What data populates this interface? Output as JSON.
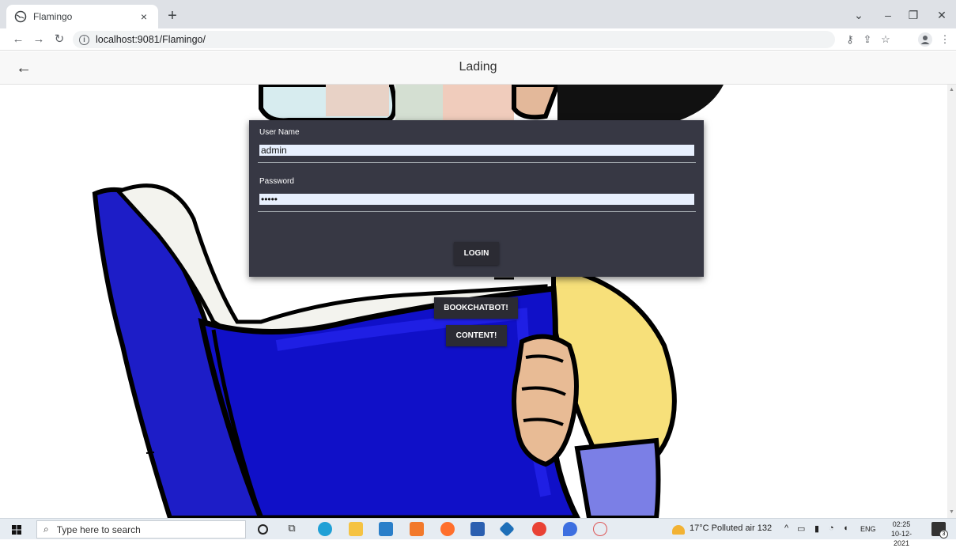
{
  "browser": {
    "tab_title": "Flamingo",
    "tab_close": "×",
    "new_tab": "+",
    "url": "localhost:9081/Flamingo/"
  },
  "app": {
    "title": "Lading"
  },
  "login": {
    "username_label": "User Name",
    "username_value": "admin",
    "password_label": "Password",
    "password_value": "•••••",
    "login_button": "LOGIN"
  },
  "actions": {
    "bookchatbot_button": "BOOKCHATBOT!",
    "content_button": "CONTENT!"
  },
  "taskbar": {
    "search_placeholder": "Type here to search",
    "weather": "17°C  Polluted air 132",
    "language": "ENG",
    "time": "02:25",
    "date": "10-12-2021",
    "notification_count": "3"
  },
  "colors": {
    "card_bg": "#373844",
    "button_bg": "#2b2b33",
    "book_blue": "#1a1acc"
  }
}
